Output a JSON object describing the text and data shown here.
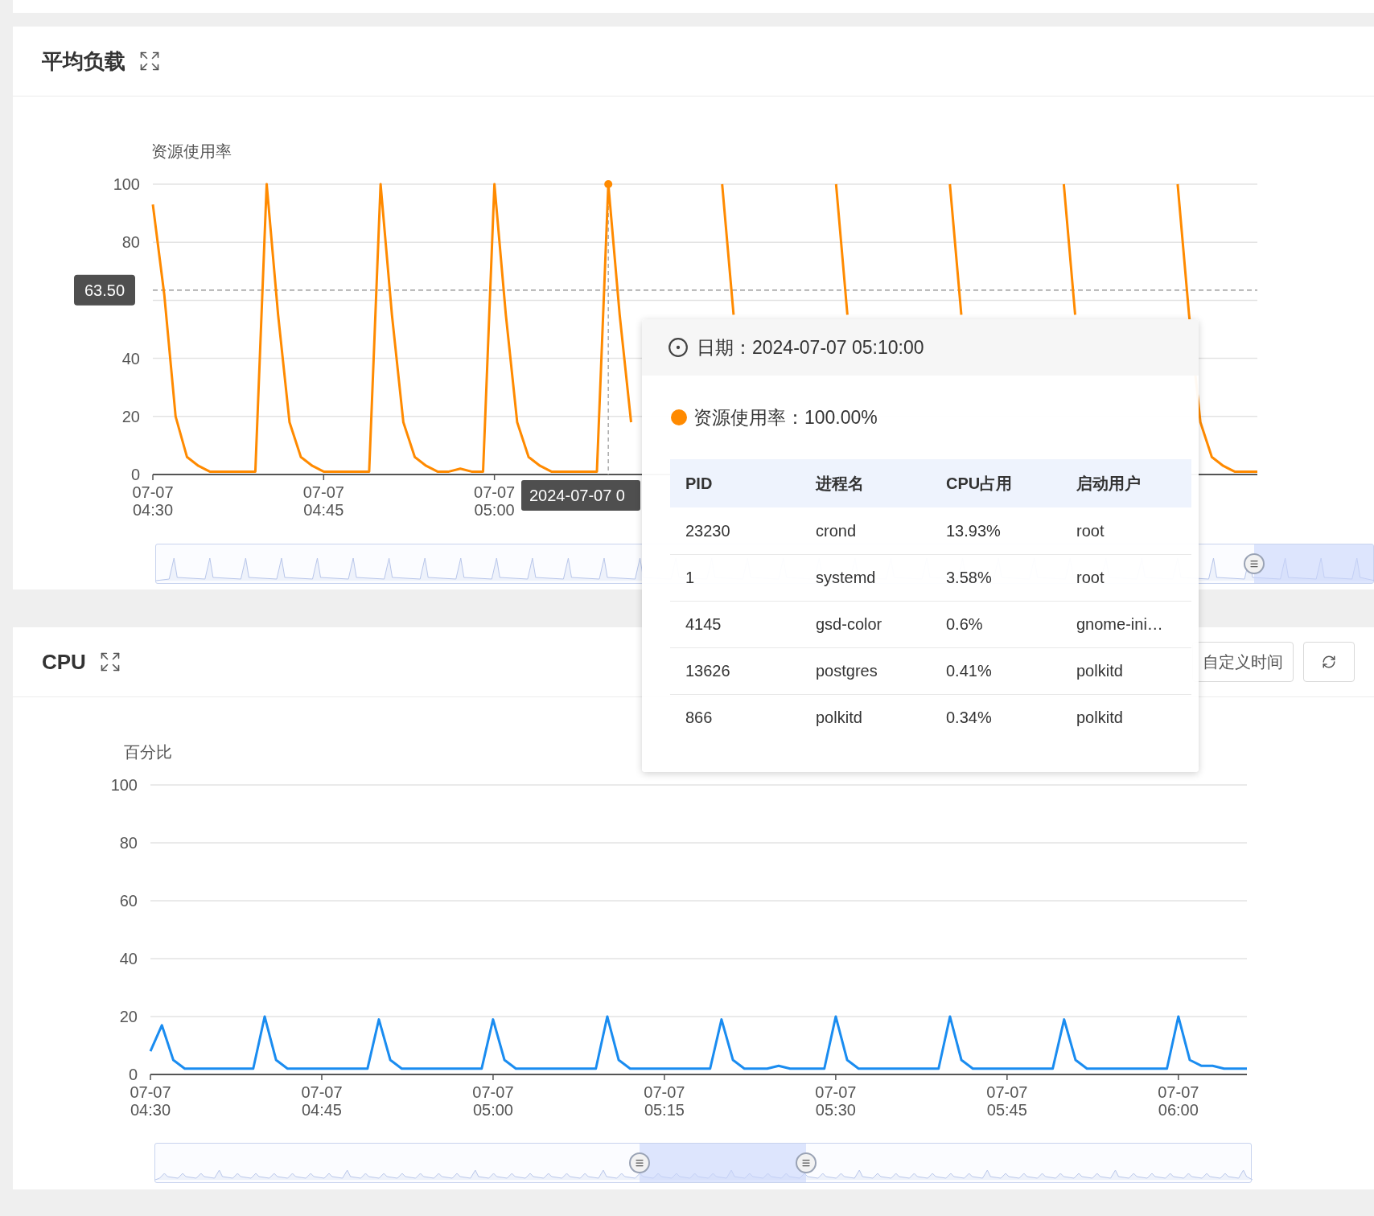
{
  "panels": [
    {
      "title": "平均负载",
      "chart_data": {
        "type": "line",
        "grid": true,
        "ylim": [
          0,
          100
        ],
        "yticks": [
          0,
          20,
          40,
          80,
          100
        ],
        "categories": [
          "07-07 04:30",
          null,
          null,
          null,
          null,
          null,
          null,
          null,
          null,
          null,
          null,
          null,
          null,
          null,
          null,
          "07-07 04:45",
          null,
          null,
          null,
          null,
          null,
          null,
          null,
          null,
          null,
          null,
          null,
          null,
          null,
          null,
          "07-07 05:00",
          null,
          null,
          null,
          null,
          null,
          null,
          null,
          null,
          null,
          null,
          null,
          null,
          null,
          null,
          null,
          null,
          null,
          null,
          null,
          null,
          null,
          null,
          null,
          null,
          null,
          null,
          null,
          null,
          null,
          null,
          null,
          null,
          null,
          null,
          null,
          null,
          null,
          null,
          null,
          null,
          null,
          null,
          null,
          null,
          null,
          null,
          null,
          null,
          null,
          null,
          null,
          null,
          null,
          null,
          null,
          null,
          null,
          null,
          null,
          null,
          null,
          null,
          null,
          null,
          null,
          null,
          null
        ],
        "series": [
          {
            "name": "资源使用率",
            "color": "#ff8a00",
            "values": [
              93,
              62,
              20,
              6,
              3,
              1,
              1,
              1,
              1,
              1,
              100,
              55,
              18,
              6,
              3,
              1,
              1,
              1,
              1,
              1,
              100,
              55,
              18,
              6,
              3,
              1,
              1,
              2,
              1,
              1,
              100,
              55,
              18,
              6,
              3,
              1,
              1,
              1,
              1,
              1,
              100,
              55,
              18,
              null,
              null,
              null,
              null,
              null,
              null,
              null,
              100,
              55,
              null,
              null,
              null,
              null,
              null,
              null,
              null,
              null,
              100,
              55,
              null,
              null,
              null,
              null,
              null,
              null,
              null,
              null,
              100,
              55,
              null,
              null,
              null,
              null,
              null,
              null,
              null,
              null,
              100,
              55,
              null,
              null,
              null,
              null,
              null,
              null,
              null,
              null,
              100,
              55,
              18,
              6,
              3,
              1,
              1,
              1
            ]
          }
        ],
        "ref_lines": [
          {
            "axis": "y",
            "value": 63.5,
            "label": "63.50"
          }
        ]
      },
      "pointer": {
        "x_label": "2024-07-07 0"
      },
      "zoom": {
        "start": {
          "level": 0.902
        }
      }
    },
    {
      "title": "CPU",
      "buttons": [
        {
          "kind": "text",
          "label": "自定义时间"
        },
        {
          "kind": "refresh"
        }
      ],
      "chart_data": {
        "type": "line",
        "grid": true,
        "ylim": [
          0,
          100
        ],
        "yticks": [
          0,
          20,
          40,
          60,
          80,
          100
        ],
        "categories": [
          "07-07 04:30",
          null,
          null,
          null,
          null,
          null,
          null,
          null,
          null,
          null,
          null,
          null,
          null,
          null,
          null,
          "07-07 04:45",
          null,
          null,
          null,
          null,
          null,
          null,
          null,
          null,
          null,
          null,
          null,
          null,
          null,
          null,
          "07-07 05:00",
          null,
          null,
          null,
          null,
          null,
          null,
          null,
          null,
          null,
          null,
          null,
          null,
          null,
          null,
          "07-07 05:15",
          null,
          null,
          null,
          null,
          null,
          null,
          null,
          null,
          null,
          null,
          null,
          null,
          null,
          null,
          "07-07 05:30",
          null,
          null,
          null,
          null,
          null,
          null,
          null,
          null,
          null,
          null,
          null,
          null,
          null,
          null,
          "07-07 05:45",
          null,
          null,
          null,
          null,
          null,
          null,
          null,
          null,
          null,
          null,
          null,
          null,
          null,
          null,
          "07-07 06:00",
          null,
          null,
          null,
          null,
          null,
          null
        ],
        "series": [
          {
            "name": "百分比",
            "color": "#1a8cf0",
            "values": [
              8,
              17,
              5,
              2,
              2,
              2,
              2,
              2,
              2,
              2,
              20,
              5,
              2,
              2,
              2,
              2,
              2,
              2,
              2,
              2,
              19,
              5,
              2,
              2,
              2,
              2,
              2,
              2,
              2,
              2,
              19,
              5,
              2,
              2,
              2,
              2,
              2,
              2,
              2,
              2,
              20,
              5,
              2,
              2,
              2,
              2,
              2,
              2,
              2,
              2,
              19,
              5,
              2,
              2,
              2,
              3,
              2,
              2,
              2,
              2,
              20,
              5,
              2,
              2,
              2,
              2,
              2,
              2,
              2,
              2,
              20,
              5,
              2,
              2,
              2,
              2,
              2,
              2,
              2,
              2,
              19,
              5,
              2,
              2,
              2,
              2,
              2,
              2,
              2,
              2,
              20,
              5,
              3,
              3,
              2,
              2,
              2
            ]
          }
        ]
      },
      "zoom": {
        "start": {
          "level": 0.442
        },
        "end": {
          "level": 0.594
        }
      }
    }
  ],
  "tooltip": {
    "title": "日期：2024-07-07 05:10:00",
    "series_label": "资源使用率：100.00%",
    "table": {
      "columns": [
        "PID",
        "进程名",
        "CPU占用",
        "启动用户"
      ],
      "rows": [
        [
          "23230",
          "crond",
          "13.93%",
          "root"
        ],
        [
          "1",
          "systemd",
          "3.58%",
          "root"
        ],
        [
          "4145",
          "gsd-color",
          "0.6%",
          "gnome-ini…"
        ],
        [
          "13626",
          "postgres",
          "0.41%",
          "polkitd"
        ],
        [
          "866",
          "polkitd",
          "0.34%",
          "polkitd"
        ]
      ]
    }
  }
}
